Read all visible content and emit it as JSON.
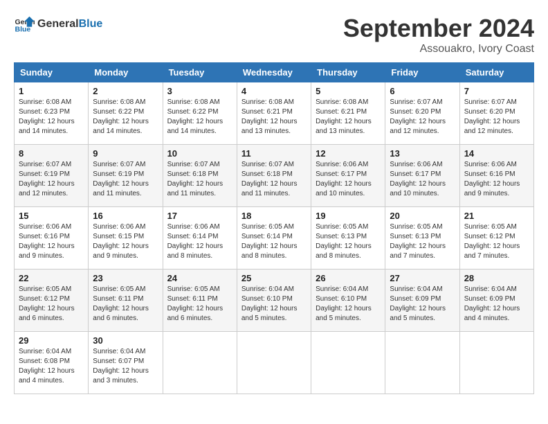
{
  "logo": {
    "text1": "General",
    "text2": "Blue"
  },
  "title": "September 2024",
  "subtitle": "Assouakro, Ivory Coast",
  "headers": [
    "Sunday",
    "Monday",
    "Tuesday",
    "Wednesday",
    "Thursday",
    "Friday",
    "Saturday"
  ],
  "weeks": [
    [
      {
        "day": "1",
        "info": "Sunrise: 6:08 AM\nSunset: 6:23 PM\nDaylight: 12 hours\nand 14 minutes."
      },
      {
        "day": "2",
        "info": "Sunrise: 6:08 AM\nSunset: 6:22 PM\nDaylight: 12 hours\nand 14 minutes."
      },
      {
        "day": "3",
        "info": "Sunrise: 6:08 AM\nSunset: 6:22 PM\nDaylight: 12 hours\nand 14 minutes."
      },
      {
        "day": "4",
        "info": "Sunrise: 6:08 AM\nSunset: 6:21 PM\nDaylight: 12 hours\nand 13 minutes."
      },
      {
        "day": "5",
        "info": "Sunrise: 6:08 AM\nSunset: 6:21 PM\nDaylight: 12 hours\nand 13 minutes."
      },
      {
        "day": "6",
        "info": "Sunrise: 6:07 AM\nSunset: 6:20 PM\nDaylight: 12 hours\nand 12 minutes."
      },
      {
        "day": "7",
        "info": "Sunrise: 6:07 AM\nSunset: 6:20 PM\nDaylight: 12 hours\nand 12 minutes."
      }
    ],
    [
      {
        "day": "8",
        "info": "Sunrise: 6:07 AM\nSunset: 6:19 PM\nDaylight: 12 hours\nand 12 minutes."
      },
      {
        "day": "9",
        "info": "Sunrise: 6:07 AM\nSunset: 6:19 PM\nDaylight: 12 hours\nand 11 minutes."
      },
      {
        "day": "10",
        "info": "Sunrise: 6:07 AM\nSunset: 6:18 PM\nDaylight: 12 hours\nand 11 minutes."
      },
      {
        "day": "11",
        "info": "Sunrise: 6:07 AM\nSunset: 6:18 PM\nDaylight: 12 hours\nand 11 minutes."
      },
      {
        "day": "12",
        "info": "Sunrise: 6:06 AM\nSunset: 6:17 PM\nDaylight: 12 hours\nand 10 minutes."
      },
      {
        "day": "13",
        "info": "Sunrise: 6:06 AM\nSunset: 6:17 PM\nDaylight: 12 hours\nand 10 minutes."
      },
      {
        "day": "14",
        "info": "Sunrise: 6:06 AM\nSunset: 6:16 PM\nDaylight: 12 hours\nand 9 minutes."
      }
    ],
    [
      {
        "day": "15",
        "info": "Sunrise: 6:06 AM\nSunset: 6:16 PM\nDaylight: 12 hours\nand 9 minutes."
      },
      {
        "day": "16",
        "info": "Sunrise: 6:06 AM\nSunset: 6:15 PM\nDaylight: 12 hours\nand 9 minutes."
      },
      {
        "day": "17",
        "info": "Sunrise: 6:06 AM\nSunset: 6:14 PM\nDaylight: 12 hours\nand 8 minutes."
      },
      {
        "day": "18",
        "info": "Sunrise: 6:05 AM\nSunset: 6:14 PM\nDaylight: 12 hours\nand 8 minutes."
      },
      {
        "day": "19",
        "info": "Sunrise: 6:05 AM\nSunset: 6:13 PM\nDaylight: 12 hours\nand 8 minutes."
      },
      {
        "day": "20",
        "info": "Sunrise: 6:05 AM\nSunset: 6:13 PM\nDaylight: 12 hours\nand 7 minutes."
      },
      {
        "day": "21",
        "info": "Sunrise: 6:05 AM\nSunset: 6:12 PM\nDaylight: 12 hours\nand 7 minutes."
      }
    ],
    [
      {
        "day": "22",
        "info": "Sunrise: 6:05 AM\nSunset: 6:12 PM\nDaylight: 12 hours\nand 6 minutes."
      },
      {
        "day": "23",
        "info": "Sunrise: 6:05 AM\nSunset: 6:11 PM\nDaylight: 12 hours\nand 6 minutes."
      },
      {
        "day": "24",
        "info": "Sunrise: 6:05 AM\nSunset: 6:11 PM\nDaylight: 12 hours\nand 6 minutes."
      },
      {
        "day": "25",
        "info": "Sunrise: 6:04 AM\nSunset: 6:10 PM\nDaylight: 12 hours\nand 5 minutes."
      },
      {
        "day": "26",
        "info": "Sunrise: 6:04 AM\nSunset: 6:10 PM\nDaylight: 12 hours\nand 5 minutes."
      },
      {
        "day": "27",
        "info": "Sunrise: 6:04 AM\nSunset: 6:09 PM\nDaylight: 12 hours\nand 5 minutes."
      },
      {
        "day": "28",
        "info": "Sunrise: 6:04 AM\nSunset: 6:09 PM\nDaylight: 12 hours\nand 4 minutes."
      }
    ],
    [
      {
        "day": "29",
        "info": "Sunrise: 6:04 AM\nSunset: 6:08 PM\nDaylight: 12 hours\nand 4 minutes."
      },
      {
        "day": "30",
        "info": "Sunrise: 6:04 AM\nSunset: 6:07 PM\nDaylight: 12 hours\nand 3 minutes."
      },
      {
        "day": "",
        "info": ""
      },
      {
        "day": "",
        "info": ""
      },
      {
        "day": "",
        "info": ""
      },
      {
        "day": "",
        "info": ""
      },
      {
        "day": "",
        "info": ""
      }
    ]
  ]
}
